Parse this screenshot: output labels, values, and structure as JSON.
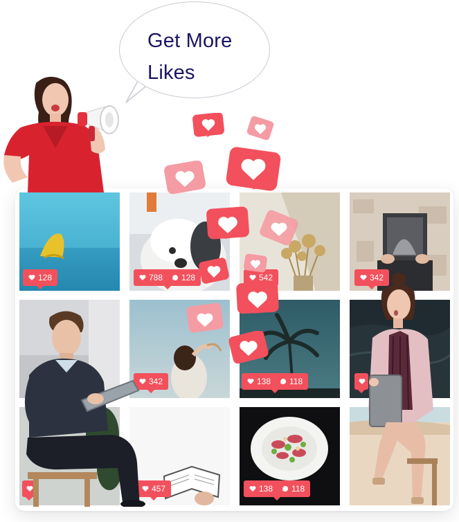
{
  "speech_bubble": {
    "line1": "Get More",
    "line2": "Likes"
  },
  "posts": [
    {
      "id": "sea-buoy",
      "likes": "128"
    },
    {
      "id": "sheepdog",
      "likes": "788",
      "comments": "128"
    },
    {
      "id": "dried-flowers",
      "likes": "542"
    },
    {
      "id": "book-cover",
      "likes": "342"
    },
    {
      "id": "man-tablet",
      "likes": ""
    },
    {
      "id": "woman-sky",
      "likes": "342"
    },
    {
      "id": "palm-tree",
      "likes": "138",
      "comments": "118"
    },
    {
      "id": "woman-surprised",
      "likes": ""
    },
    {
      "id": "seat",
      "likes": ""
    },
    {
      "id": "open-book",
      "likes": "457"
    },
    {
      "id": "salad-plate",
      "likes": "138",
      "comments": "118"
    },
    {
      "id": "beach-stool",
      "likes": ""
    }
  ],
  "colors": {
    "like_red": "#f2505c",
    "like_pink": "#f59ba3",
    "title_navy": "#1b1464"
  },
  "icons": [
    "heart-icon",
    "comment-icon",
    "megaphone-icon"
  ]
}
